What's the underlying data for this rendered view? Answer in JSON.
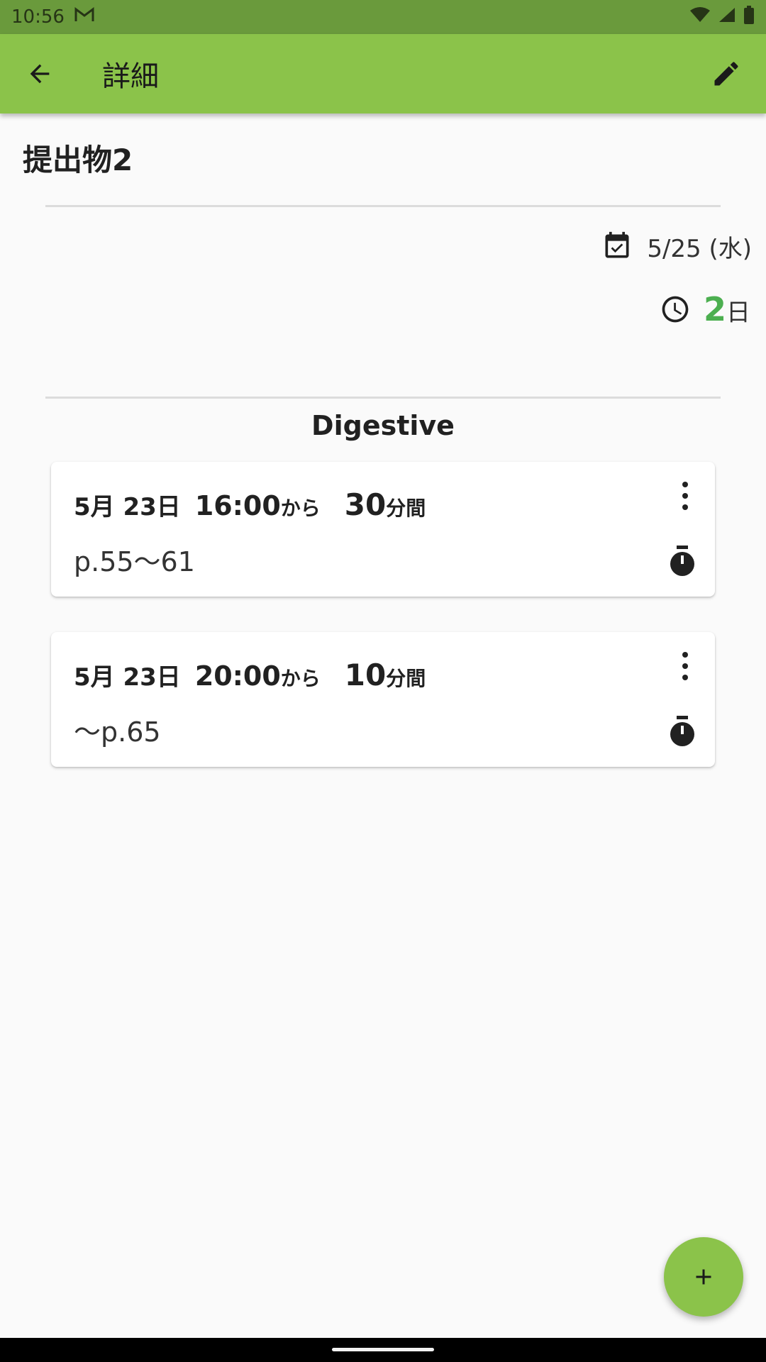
{
  "status_bar": {
    "time": "10:56",
    "icons": [
      "gmail-icon",
      "wifi-icon",
      "signal-icon",
      "battery-icon"
    ]
  },
  "app_bar": {
    "title": "詳細",
    "back_icon": "arrow-back-icon",
    "edit_icon": "pencil-icon"
  },
  "task": {
    "title": "提出物2",
    "due_date": "5/25 (水)",
    "remaining_number": "2",
    "remaining_unit": "日"
  },
  "subject": "Digestive",
  "sessions": [
    {
      "date": "5月 23日",
      "time": "16:00",
      "from": "から",
      "duration": "30",
      "duration_unit": "分間",
      "memo": "p.55〜61"
    },
    {
      "date": "5月 23日",
      "time": "20:00",
      "from": "から",
      "duration": "10",
      "duration_unit": "分間",
      "memo": "〜p.65"
    }
  ],
  "colors": {
    "primary": "#8bc34a",
    "status_bar": "#6a9a3c",
    "accent_green": "#4caf50"
  }
}
